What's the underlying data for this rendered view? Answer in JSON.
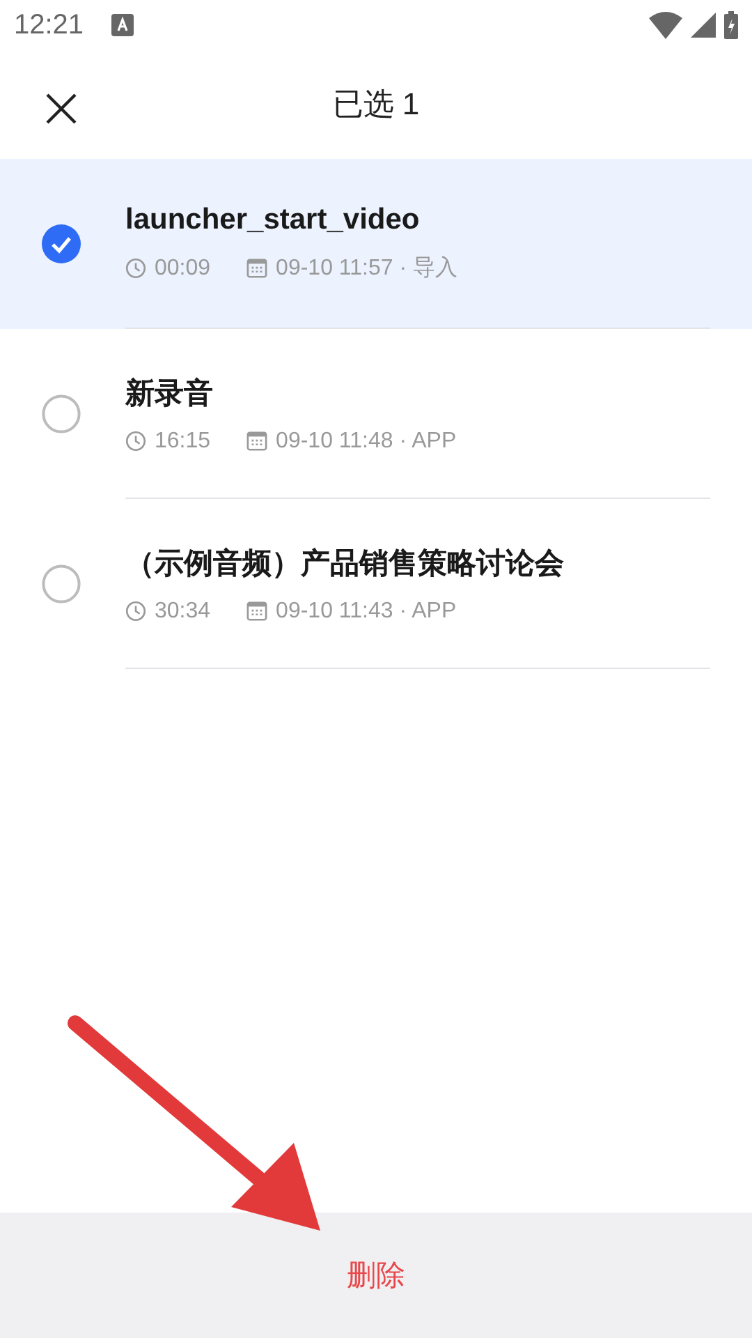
{
  "status_bar": {
    "time": "12:21"
  },
  "header": {
    "title": "已选 1"
  },
  "recordings": [
    {
      "name": "launcher_start_video",
      "duration": "00:09",
      "date": "09-10 11:57 · 导入",
      "selected": true
    },
    {
      "name": "新录音",
      "duration": "16:15",
      "date": "09-10 11:48 · APP",
      "selected": false
    },
    {
      "name": "（示例音频）产品销售策略讨论会",
      "duration": "30:34",
      "date": "09-10 11:43 · APP",
      "selected": false
    }
  ],
  "bottom_bar": {
    "action": "删除"
  }
}
